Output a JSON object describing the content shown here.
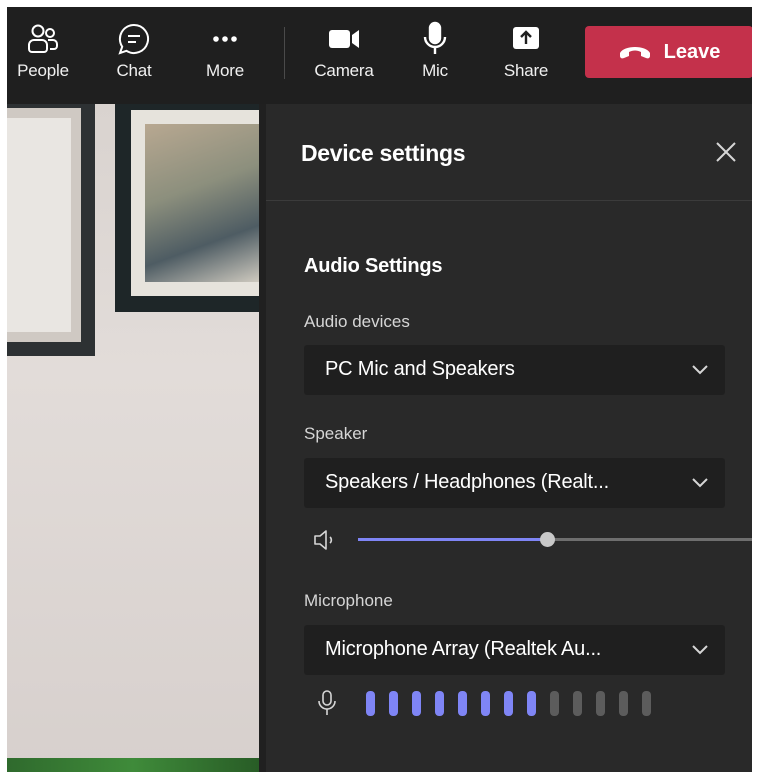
{
  "toolbar": {
    "people_label": "People",
    "chat_label": "Chat",
    "more_label": "More",
    "camera_label": "Camera",
    "mic_label": "Mic",
    "share_label": "Share",
    "leave_label": "Leave"
  },
  "panel": {
    "title": "Device settings",
    "section_title": "Audio Settings",
    "audio_devices": {
      "label": "Audio devices",
      "value": "PC Mic and Speakers"
    },
    "speaker": {
      "label": "Speaker",
      "value": "Speakers / Headphones (Realt...",
      "volume_percent": 48
    },
    "microphone": {
      "label": "Microphone",
      "value": "Microphone Array (Realtek Au...",
      "level_bars_total": 13,
      "level_bars_active": 8
    }
  },
  "colors": {
    "leave_red": "#c4314b",
    "accent": "#7f85f5",
    "meter_inactive": "#5c5c5c",
    "panel_bg": "#292929",
    "dropdown_bg": "#1f1f1f"
  },
  "icons": {
    "people": "people-icon",
    "chat": "chat-icon",
    "more": "more-icon",
    "camera": "camera-icon",
    "mic": "mic-icon",
    "share": "share-icon",
    "leave": "phone-hangup-icon",
    "close": "close-icon",
    "dropdown": "chevron-down-icon",
    "speaker": "speaker-icon",
    "mic_level": "mic-icon"
  }
}
